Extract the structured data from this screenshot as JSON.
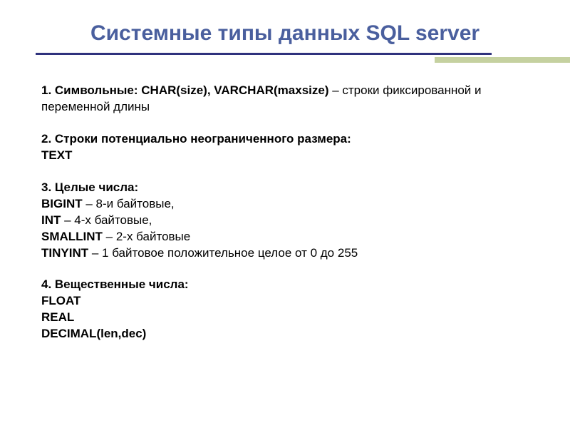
{
  "title": "Системные типы данных SQL server",
  "section1": {
    "lead_bold": "1. Символьные: CHAR(size), VARCHAR(maxsize)",
    "lead_rest": " – строки фиксированной и переменной длины"
  },
  "section2": {
    "line1": "2. Строки потенциально неограниченного размера:",
    "line2": "TEXT"
  },
  "section3": {
    "header": "3. Целые числа:",
    "l1_bold": "BIGINT",
    "l1_rest": " – 8-и байтовые,",
    "l2_bold": "INT",
    "l2_rest": " – 4-х байтовые,",
    "l3_bold": "SMALLINT",
    "l3_rest": " – 2-х байтовые",
    "l4_bold": "TINYINT",
    "l4_rest": " – 1 байтовое положительное целое от 0 до 255"
  },
  "section4": {
    "header": "4. Вещественные числа:",
    "l1": "FLOAT",
    "l2": "REAL",
    "l3": "DECIMAL(len,dec)"
  }
}
